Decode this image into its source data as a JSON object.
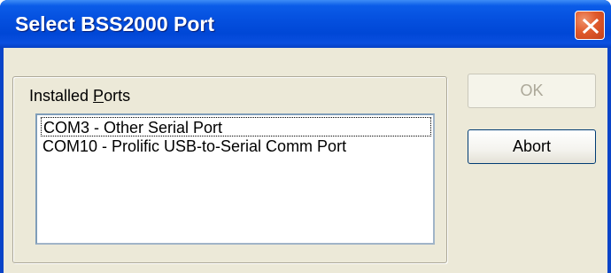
{
  "window": {
    "title": "Select BSS2000 Port",
    "close_icon": "close-x-icon"
  },
  "ports_group": {
    "label_prefix": "Installed ",
    "label_accel": "P",
    "label_suffix": "orts",
    "items": [
      {
        "label": "COM3 - Other Serial Port",
        "focused": true
      },
      {
        "label": "COM10 - Prolific USB-to-Serial Comm Port",
        "focused": false
      }
    ]
  },
  "buttons": {
    "ok_label": "OK",
    "ok_enabled": false,
    "abort_label": "Abort"
  },
  "colors": {
    "titlebar": "#0054e3",
    "face": "#ece9d8",
    "close_button": "#e05a2c"
  }
}
